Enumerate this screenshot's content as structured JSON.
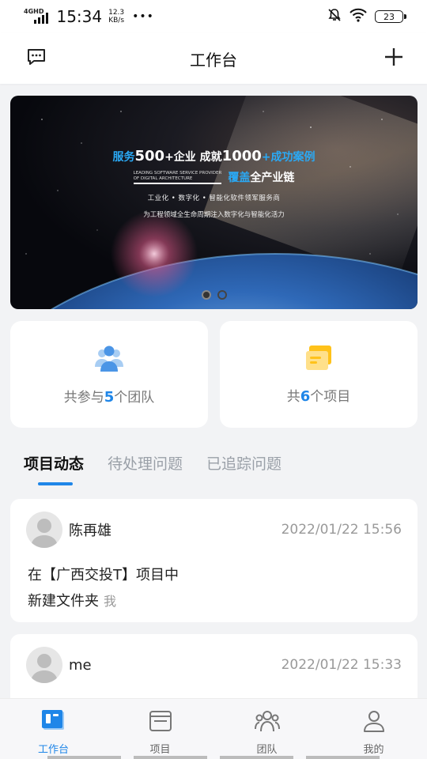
{
  "status_bar": {
    "network": "4GHD",
    "time": "15:34",
    "speed_value": "12.3",
    "speed_unit": "KB/s",
    "more": "•••",
    "battery": "23"
  },
  "header": {
    "title": "工作台",
    "left_icon": "message-icon",
    "right_icon": "plus-icon"
  },
  "banner": {
    "line1_a": "服务",
    "line1_b": "500",
    "line1_c": "+企业  成就",
    "line1_d": "1000",
    "line1_e": "+成功案例",
    "en_line1": "LEADING SOFTWARE SERVICE PROVIDER",
    "en_line2": "OF DIGITAL ARCHITECTURE",
    "cover_a": "覆盖",
    "cover_b": "全产业链",
    "line3": "工业化 • 数字化 • 智能化软件领军服务商",
    "line4": "为工程领域全生命周期注入数字化与智能化活力",
    "active_slide": 1,
    "slide_count": 2
  },
  "stats": {
    "teams": {
      "prefix": "共参与",
      "count": "5",
      "suffix": "个团队",
      "icon": "team-icon"
    },
    "projects": {
      "prefix": "共",
      "count": "6",
      "suffix": "个项目",
      "icon": "project-folder-icon"
    }
  },
  "tabs": [
    {
      "label": "项目动态",
      "active": true
    },
    {
      "label": "待处理问题",
      "active": false
    },
    {
      "label": "已追踪问题",
      "active": false
    }
  ],
  "feed": [
    {
      "name": "陈再雄",
      "time": "2022/01/22 15:56",
      "line1": "在【广西交投T】项目中",
      "line2": "新建文件夹",
      "who": "我"
    },
    {
      "name": "me",
      "time": "2022/01/22 15:33"
    }
  ],
  "bottom_nav": [
    {
      "label": "工作台",
      "icon": "workbench-icon",
      "active": true
    },
    {
      "label": "项目",
      "icon": "project-icon",
      "active": false
    },
    {
      "label": "团队",
      "icon": "team-nav-icon",
      "active": false
    },
    {
      "label": "我的",
      "icon": "profile-icon",
      "active": false
    }
  ],
  "colors": {
    "accent": "#1f86e8",
    "banner_blue": "#2aa9f5"
  }
}
